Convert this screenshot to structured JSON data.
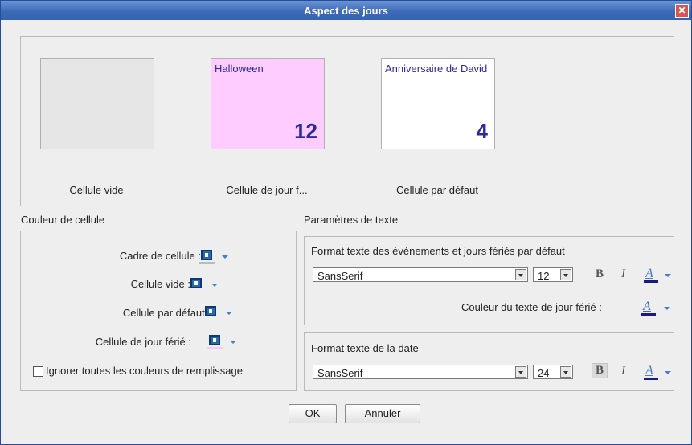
{
  "window": {
    "title": "Aspect des jours",
    "close_icon": "close-icon"
  },
  "preview": {
    "empty_caption": "Cellule vide",
    "holiday": {
      "event": "Halloween",
      "day": "12",
      "caption": "Cellule de jour f...",
      "bg_color": "#ffccff"
    },
    "default": {
      "event": "Anniversaire de David",
      "day": "4",
      "caption": "Cellule par défaut",
      "bg_color": "#ffffff"
    },
    "empty_bg_color": "#e6e6e6",
    "text_color": "#2a2aa0"
  },
  "cell_color": {
    "title": "Couleur de cellule",
    "rows": [
      {
        "label": "Cadre de cellule :",
        "underline": "#bbbbbb"
      },
      {
        "label": "Cellule vide :",
        "underline": "#eeeeee"
      },
      {
        "label": "Cellule par défaut :",
        "underline": "#eeeeee"
      },
      {
        "label": "Cellule de jour férié :",
        "underline": "#f5c8f5"
      }
    ],
    "ignore_fill_label": "Ignorer toutes les couleurs de remplissage",
    "ignore_fill_checked": false
  },
  "text_params": {
    "title": "Paramètres de texte",
    "events_format": {
      "title": "Format texte des événements et jours fériés par défaut",
      "font": "SansSerif",
      "size": "12",
      "bold_label": "B",
      "italic_label": "I",
      "font_color_label": "A",
      "holiday_color_label": "Couleur du texte de jour férié :"
    },
    "date_format": {
      "title": "Format texte de la date",
      "font": "SansSerif",
      "size": "24",
      "bold_label": "B",
      "italic_label": "I",
      "font_color_label": "A"
    }
  },
  "buttons": {
    "ok": "OK",
    "cancel": "Annuler"
  }
}
